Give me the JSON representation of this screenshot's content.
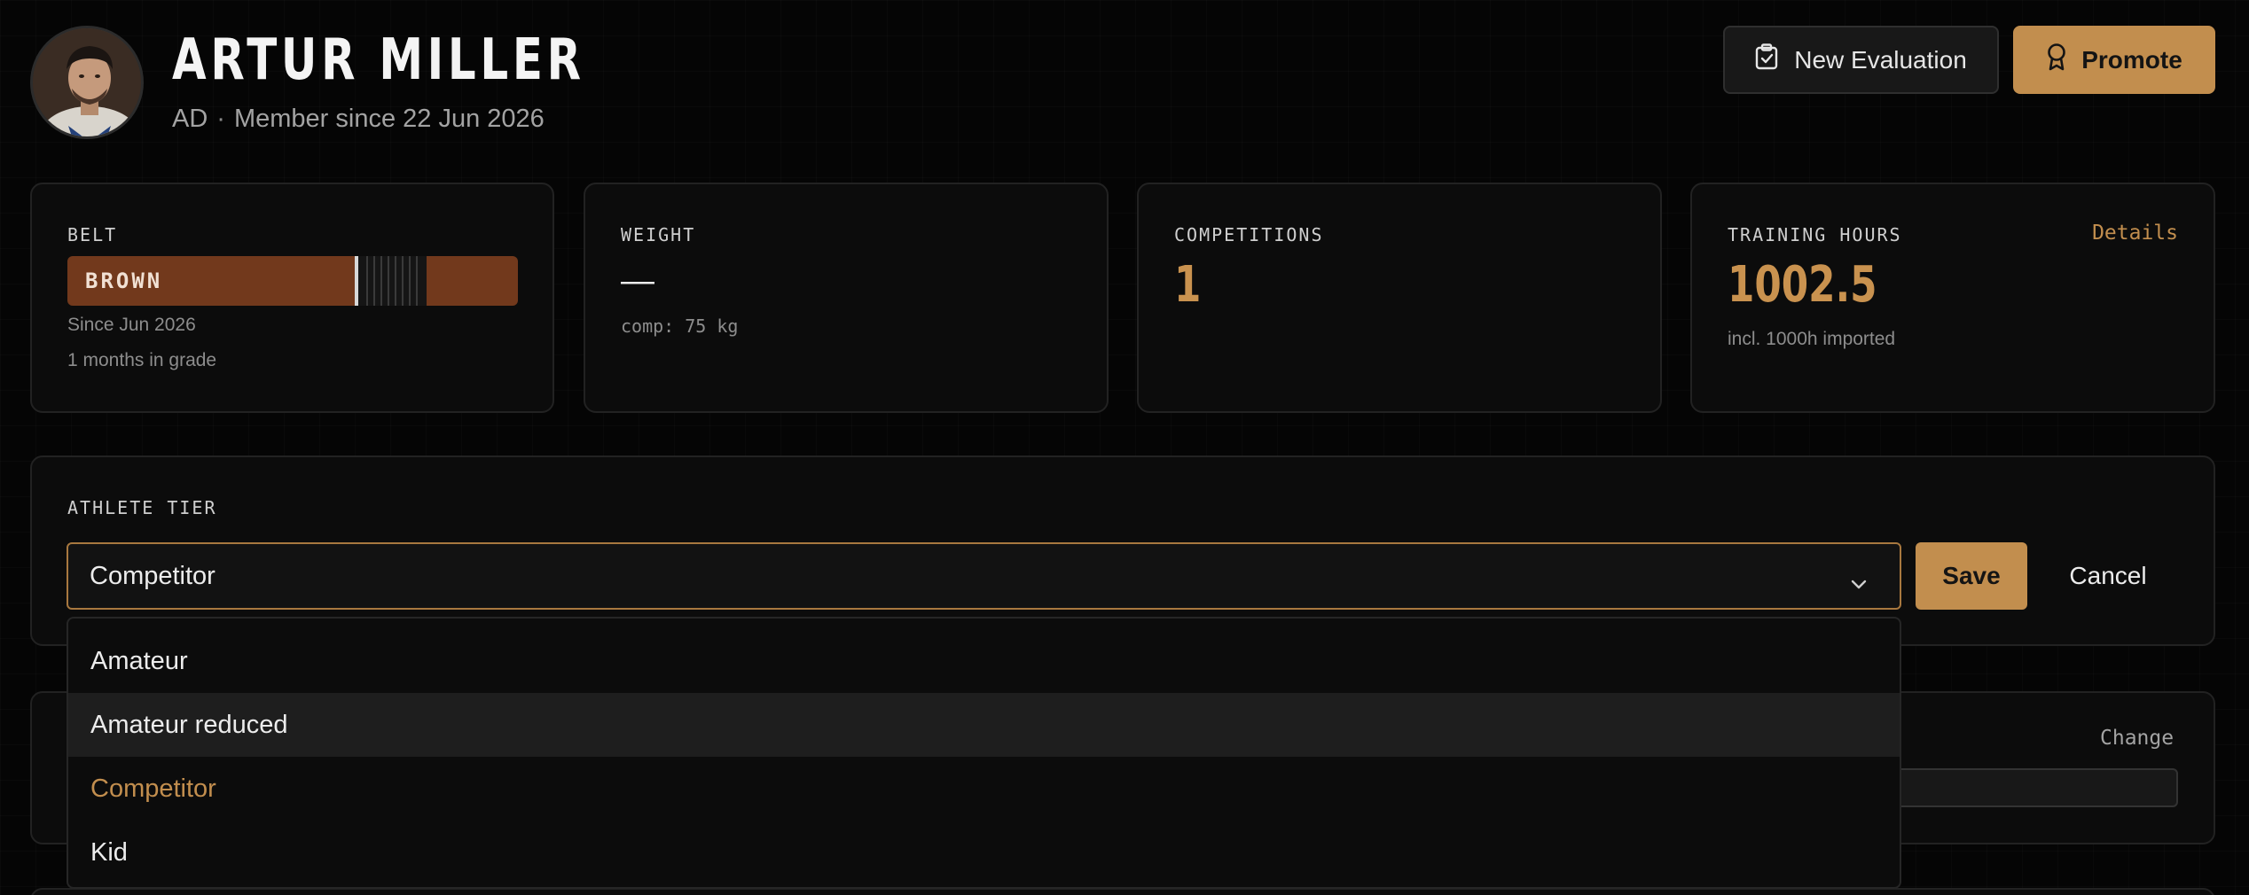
{
  "profile": {
    "name": "ARTUR MILLER",
    "initials": "AD",
    "member_since": "Member since 22 Jun 2026"
  },
  "actions": {
    "new_evaluation": "New Evaluation",
    "promote": "Promote"
  },
  "cards": {
    "belt": {
      "label": "BELT",
      "belt_name": "BROWN",
      "belt_color": "#72391c",
      "stripes": 0,
      "since": "Since Jun 2026",
      "months_in_grade": "1 months in grade"
    },
    "weight": {
      "label": "WEIGHT",
      "value": "—",
      "comp": "comp: 75 kg"
    },
    "competitions": {
      "label": "COMPETITIONS",
      "value": "1"
    },
    "training_hours": {
      "label": "TRAINING HOURS",
      "details": "Details",
      "value": "1002.5",
      "note": "incl. 1000h imported"
    }
  },
  "athlete_tier": {
    "label": "ATHLETE TIER",
    "selected": "Competitor",
    "save": "Save",
    "cancel": "Cancel",
    "options": [
      "Amateur",
      "Amateur reduced",
      "Competitor",
      "Kid"
    ],
    "hovered_option": "Amateur reduced"
  },
  "hidden_section": {
    "change": "Change"
  },
  "colors": {
    "accent": "#c28e4e",
    "background": "#050505",
    "card": "#0c0c0c"
  }
}
